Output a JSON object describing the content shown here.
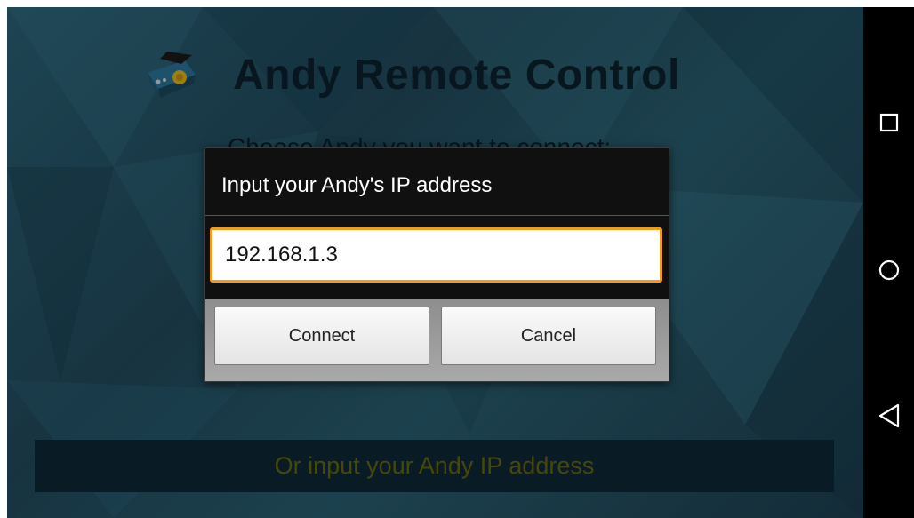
{
  "app": {
    "title": "Andy Remote Control",
    "choose_label": "Choose Andy you want to connect:",
    "ip_bar_label": "Or input your Andy IP address"
  },
  "dialog": {
    "title": "Input your Andy's IP address",
    "ip_value": "192.168.1.3",
    "connect_label": "Connect",
    "cancel_label": "Cancel"
  },
  "nav": {
    "recents_icon": "square-icon",
    "home_icon": "circle-icon",
    "back_icon": "triangle-back-icon"
  },
  "colors": {
    "accent": "#f29a1a",
    "background": "#2c6578",
    "ip_bar_text": "#6e6e12"
  }
}
